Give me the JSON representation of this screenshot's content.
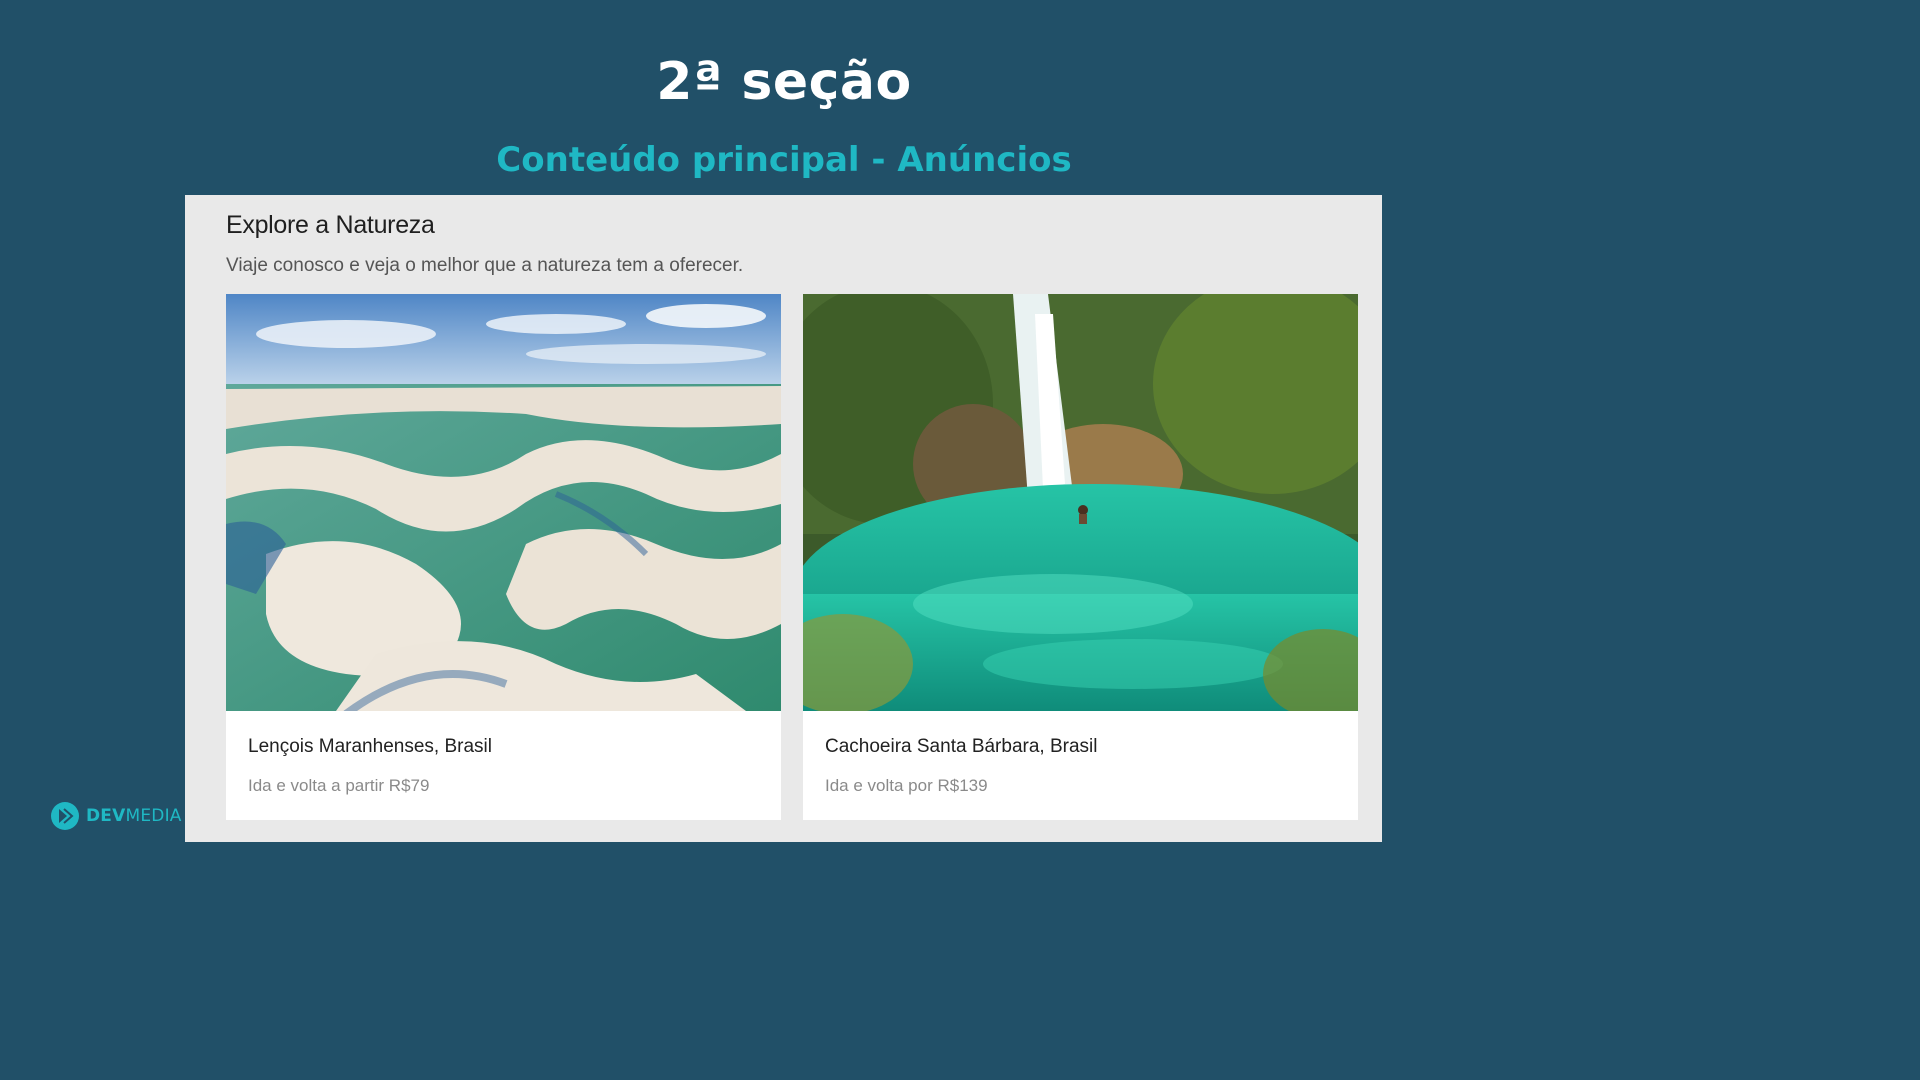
{
  "slide": {
    "title": "2ª seção",
    "subtitle": "Conteúdo principal - Anúncios"
  },
  "panel": {
    "heading": "Explore a Natureza",
    "description": "Viaje conosco e veja o melhor que a natureza tem a oferecer."
  },
  "cards": [
    {
      "title": "Lençois Maranhenses, Brasil",
      "price_text": "Ida e volta a partir R$79",
      "image": "sand-dunes-lagoons-photo"
    },
    {
      "title": "Cachoeira Santa Bárbara, Brasil",
      "price_text": "Ida e volta por R$139",
      "image": "waterfall-pool-photo"
    }
  ],
  "logo": {
    "bold_text": "DEV",
    "light_text": "MEDIA",
    "icon": "devmedia-logo-icon"
  },
  "colors": {
    "background": "#215068",
    "accent": "#1fb8c4",
    "panel": "#e9e9e9"
  }
}
